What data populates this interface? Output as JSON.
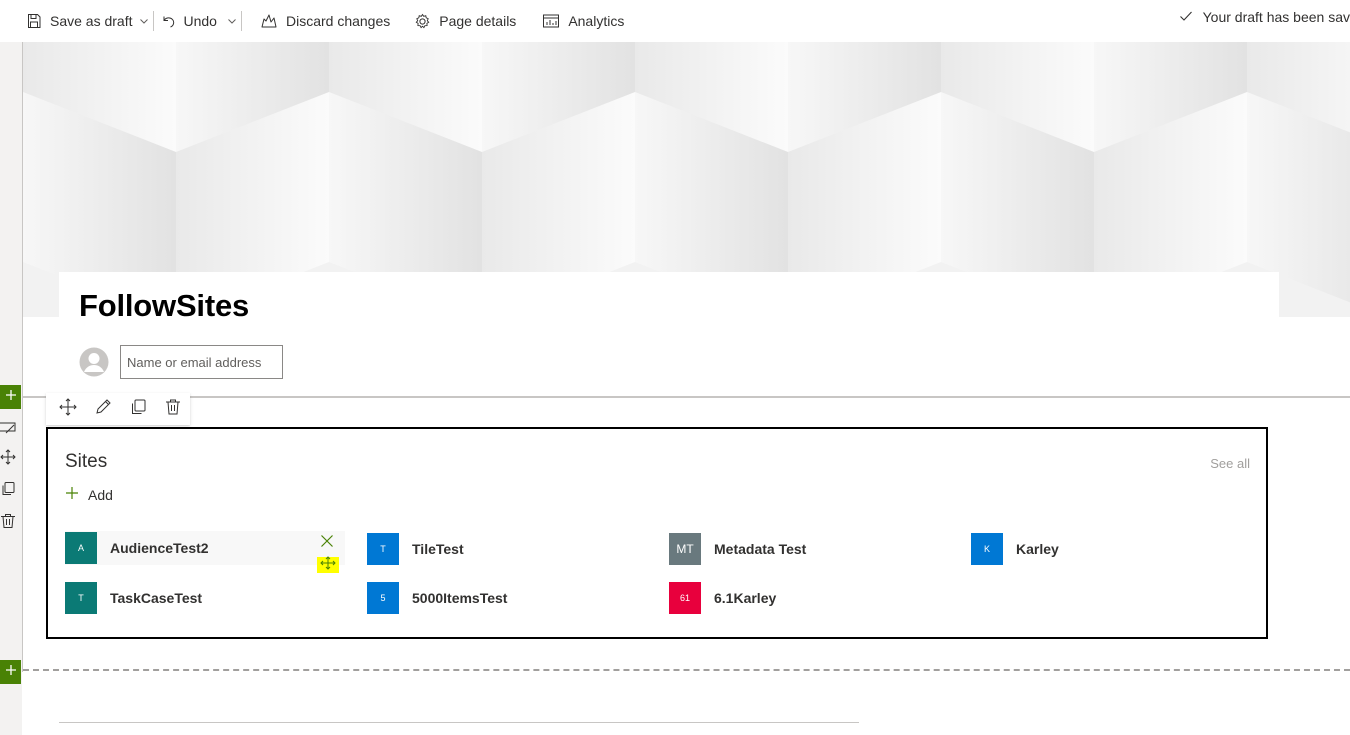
{
  "command_bar": {
    "save_as_draft": "Save as draft",
    "undo": "Undo",
    "discard_changes": "Discard changes",
    "page_details": "Page details",
    "analytics": "Analytics",
    "draft_status": "Your draft has been sav"
  },
  "page": {
    "title": "FollowSites",
    "author_placeholder": "Name or email address"
  },
  "sites_webpart": {
    "title": "Sites",
    "see_all": "See all",
    "add_label": "Add",
    "sites": [
      {
        "initials": "A",
        "name": "AudienceTest2",
        "color": "#0b7a75"
      },
      {
        "initials": "T",
        "name": "TileTest",
        "color": "#0078d4"
      },
      {
        "initials": "MT",
        "name": "Metadata Test",
        "color": "#69797e"
      },
      {
        "initials": "K",
        "name": "Karley",
        "color": "#0078d4"
      },
      {
        "initials": "T",
        "name": "TaskCaseTest",
        "color": "#0b7a75"
      },
      {
        "initials": "5",
        "name": "5000ItemsTest",
        "color": "#0078d4"
      },
      {
        "initials": "61",
        "name": "6.1Karley",
        "color": "#e3008c"
      }
    ]
  },
  "colors": {
    "accent_green": "#498205",
    "highlight_yellow": "#ffff00",
    "magenta_tile": "#e8003d"
  }
}
